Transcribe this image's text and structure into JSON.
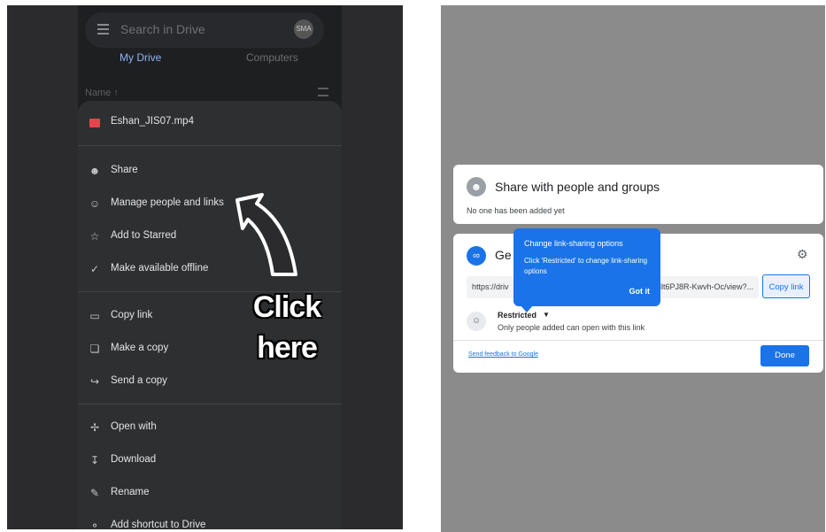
{
  "left": {
    "search_placeholder": "Search in Drive",
    "avatar_text": "SMA",
    "tabs": [
      "My Drive",
      "Computers"
    ],
    "sort_label": "Name ↑",
    "file_name": "Eshan_JIS07.mp4",
    "menu": [
      {
        "label": "Share",
        "icon": "person-add-icon"
      },
      {
        "label": "Manage people and links",
        "icon": "people-icon"
      },
      {
        "label": "Add to Starred",
        "icon": "star-icon"
      },
      {
        "label": "Make available offline",
        "icon": "offline-check-icon"
      },
      {
        "label": "Copy link",
        "icon": "copy-link-icon"
      },
      {
        "label": "Make a copy",
        "icon": "copy-icon"
      },
      {
        "label": "Send a copy",
        "icon": "forward-icon"
      },
      {
        "label": "Open with",
        "icon": "open-with-icon"
      },
      {
        "label": "Download",
        "icon": "download-icon"
      },
      {
        "label": "Rename",
        "icon": "pencil-icon"
      },
      {
        "label": "Add shortcut to Drive",
        "icon": "shortcut-icon"
      }
    ],
    "annotation": [
      "Click",
      "here"
    ]
  },
  "right": {
    "share_title": "Share with people and groups",
    "share_sub": "No one has been added yet",
    "get_link_title": "Ge",
    "url_start": "https://driv",
    "url_end": "Hlt6PJ8R-Kwvh-Oc/view?...",
    "copy_link": "Copy link",
    "access_label": "Restricted",
    "access_sub": "Only people added can open with this link",
    "feedback": "Send feedback to Google",
    "done": "Done",
    "tooltip": {
      "title": "Change link-sharing options",
      "body": "Click 'Restricted' to change link-sharing options",
      "button": "Got it"
    }
  },
  "colors": {
    "accent": "#1a73e8",
    "dark_bg": "#1e1f21",
    "sheet_bg": "#2e2f31",
    "overlay": "#8b8b8b"
  }
}
